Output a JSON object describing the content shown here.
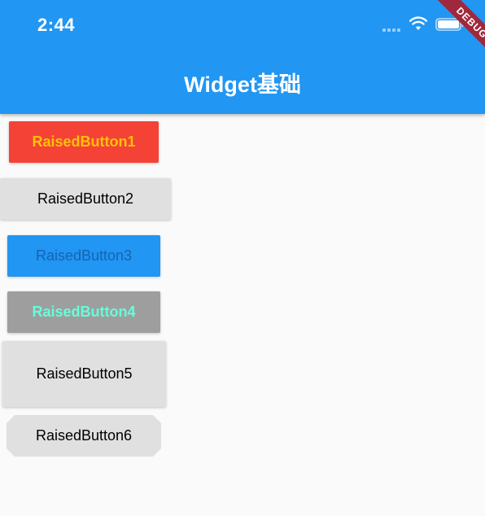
{
  "status_bar": {
    "time": "2:44"
  },
  "app_bar": {
    "title": "Widget基础",
    "color": "#2196f3"
  },
  "debug_banner": {
    "label": "DEBUG"
  },
  "buttons": [
    {
      "label": "RaisedButton1",
      "background": "#f44336",
      "text_color": "#ffc107"
    },
    {
      "label": "RaisedButton2",
      "background": "#e0e0e0",
      "text_color": "#000000"
    },
    {
      "label": "RaisedButton3",
      "background": "#2196f3",
      "text_color": "#1565b0"
    },
    {
      "label": "RaisedButton4",
      "background": "#9e9e9e",
      "text_color": "#64ffda"
    },
    {
      "label": "RaisedButton5",
      "background": "#e0e0e0",
      "text_color": "#000000"
    },
    {
      "label": "RaisedButton6",
      "background": "#e0e0e0",
      "text_color": "#000000",
      "shape": "beveled"
    }
  ],
  "icons": [
    "wifi-icon",
    "battery-icon",
    "signal-icon"
  ]
}
